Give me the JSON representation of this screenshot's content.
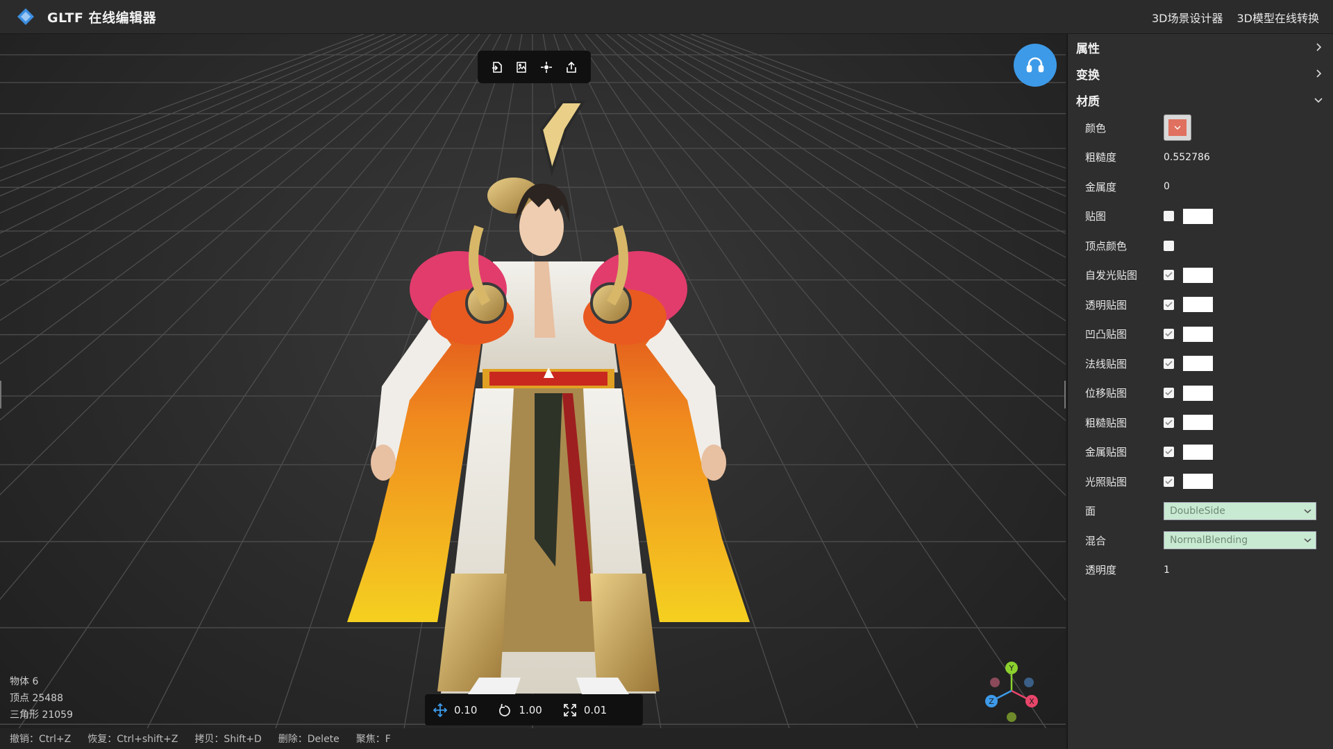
{
  "app": {
    "title": "GLTF 在线编辑器"
  },
  "nav": {
    "scene_designer": "3D场景设计器",
    "model_converter": "3D模型在线转换"
  },
  "colors": {
    "accent": "#3d9ae8",
    "material_color": "#e0705f",
    "select_bg": "#c9ead2"
  },
  "toolbar": {
    "icons": [
      "import-icon",
      "export-image-icon",
      "light-icon",
      "share-icon"
    ]
  },
  "stats": {
    "objects": "物体 6",
    "vertices": "顶点 25488",
    "triangles": "三角形 21059"
  },
  "controls": {
    "translate": "0.10",
    "rotate": "1.00",
    "scale": "0.01"
  },
  "hotkeys": [
    "撤销：Ctrl+Z",
    "恢复：Ctrl+shift+Z",
    "拷贝：Shift+D",
    "删除：Delete",
    "聚焦：F"
  ],
  "gizmo": {
    "x": "X",
    "y": "Y",
    "z": "Z"
  },
  "panel": {
    "sections": {
      "properties": "属性",
      "transform": "变换",
      "material": "材质"
    },
    "material": {
      "color_label": "颜色",
      "roughness_label": "粗糙度",
      "roughness": "0.552786",
      "metalness_label": "金属度",
      "metalness": "0",
      "map_label": "贴图",
      "vertex_colors_label": "顶点颜色",
      "emissive_map_label": "自发光贴图",
      "alpha_map_label": "透明贴图",
      "bump_map_label": "凹凸贴图",
      "normal_map_label": "法线贴图",
      "displacement_map_label": "位移贴图",
      "roughness_map_label": "粗糙贴图",
      "metalness_map_label": "金属贴图",
      "light_map_label": "光照贴图",
      "side_label": "面",
      "side": "DoubleSide",
      "blending_label": "混合",
      "blending": "NormalBlending",
      "opacity_label": "透明度",
      "opacity": "1"
    }
  }
}
